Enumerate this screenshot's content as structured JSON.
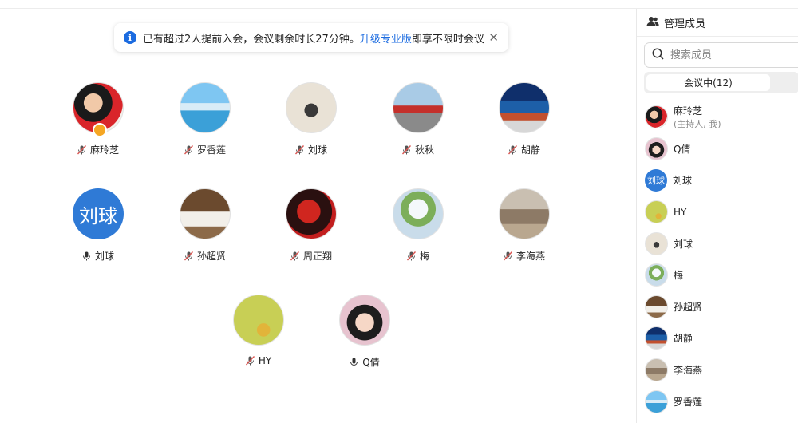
{
  "notice": {
    "text_before": "已有超过2人提前入会，会议剩余时长27分钟。",
    "link": "升级专业版",
    "text_after": "即享不限时会议"
  },
  "tiles": [
    {
      "name": "麻玲芝",
      "mic": "muted",
      "host": true
    },
    {
      "name": "罗香莲",
      "mic": "muted"
    },
    {
      "name": "刘球",
      "mic": "muted"
    },
    {
      "name": "秋秋",
      "mic": "muted"
    },
    {
      "name": "胡静",
      "mic": "muted"
    },
    {
      "name": "刘球",
      "mic": "on",
      "avatar_text": "刘球"
    },
    {
      "name": "孙超贤",
      "mic": "muted"
    },
    {
      "name": "周正翔",
      "mic": "muted"
    },
    {
      "name": "梅",
      "mic": "muted"
    },
    {
      "name": "李海燕",
      "mic": "muted"
    },
    {
      "name": "HY",
      "mic": "muted"
    },
    {
      "name": "Q倩",
      "mic": "on"
    }
  ],
  "sidebar": {
    "title": "管理成员",
    "search_placeholder": "搜索成员",
    "tab_in_meeting": "会议中(12)",
    "members": [
      {
        "name": "麻玲芝",
        "sub": "(主持人, 我)"
      },
      {
        "name": "Q倩"
      },
      {
        "name": "刘球",
        "avatar_text": "刘球"
      },
      {
        "name": "HY"
      },
      {
        "name": "刘球"
      },
      {
        "name": "梅"
      },
      {
        "name": "孙超贤"
      },
      {
        "name": "胡静"
      },
      {
        "name": "李海燕"
      },
      {
        "name": "罗香莲"
      }
    ]
  },
  "colors": {
    "accent": "#1b6be0",
    "avatar_blue": "#2f7ad6",
    "muted_red": "#d9534f"
  }
}
